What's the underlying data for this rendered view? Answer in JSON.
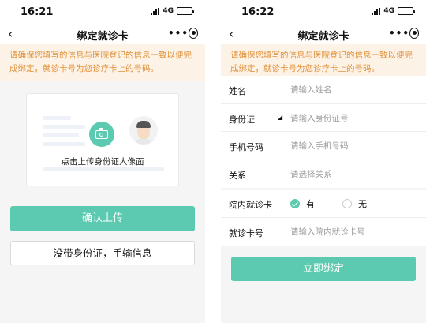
{
  "left": {
    "status": {
      "time": "16:21",
      "network": "4G"
    },
    "nav": {
      "back": "‹",
      "title": "绑定就诊卡",
      "more": "•••"
    },
    "notice": "请确保您填写的信息与医院登记的信息一致以便完成绑定，就诊卡号为您诊疗卡上的号码。",
    "upload": {
      "label": "点击上传身份证人像面"
    },
    "buttons": {
      "confirm": "确认上传",
      "manual": "没带身份证，手输信息"
    }
  },
  "right": {
    "status": {
      "time": "16:22",
      "network": "4G"
    },
    "nav": {
      "back": "‹",
      "title": "绑定就诊卡",
      "more": "•••"
    },
    "notice": "请确保您填写的信息与医院登记的信息一致以便完成绑定，就诊卡号为您诊疗卡上的号码。",
    "form": {
      "name": {
        "label": "姓名",
        "placeholder": "请输入姓名"
      },
      "id_card": {
        "label": "身份证",
        "caret": "◢",
        "placeholder": "请输入身份证号"
      },
      "phone": {
        "label": "手机号码",
        "placeholder": "请输入手机号码"
      },
      "relation": {
        "label": "关系",
        "placeholder": "请选择关系"
      }
    },
    "hospital_card": {
      "label": "院内就诊卡",
      "options": [
        {
          "label": "有",
          "checked": true
        },
        {
          "label": "无",
          "checked": false
        }
      ]
    },
    "card_no": {
      "label": "就诊卡号",
      "placeholder": "请输入院内就诊卡号"
    },
    "submit": "立即绑定"
  },
  "colors": {
    "accent": "#5ccab0",
    "notice_bg": "#fdf2e6",
    "notice_text": "#e0913a"
  },
  "icons": {
    "back": "chevron-left-icon",
    "more": "more-dots-icon",
    "close": "target-close-icon",
    "camera": "camera-icon",
    "avatar": "avatar-icon"
  }
}
